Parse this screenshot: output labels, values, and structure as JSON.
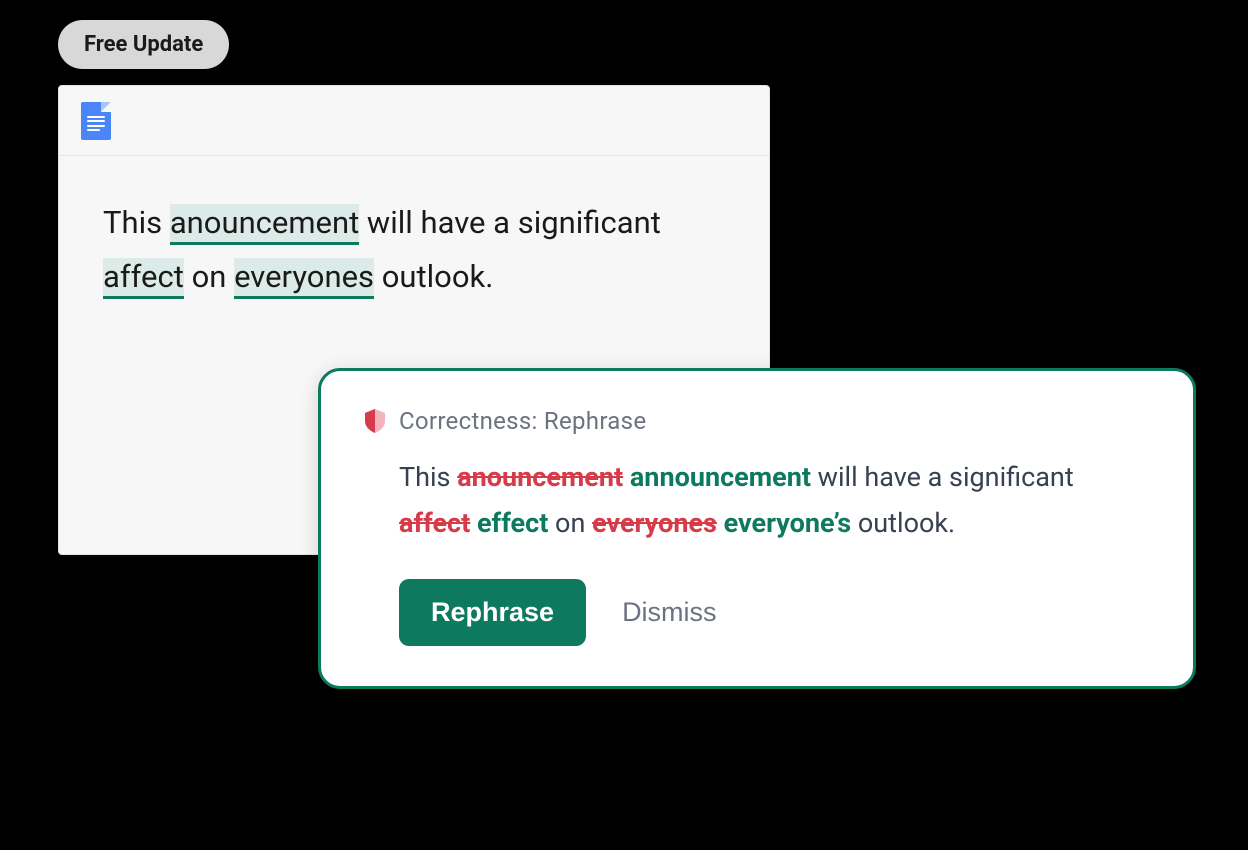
{
  "badge": "Free Update",
  "document": {
    "text_parts": [
      "This ",
      "anouncement",
      " will have a significant ",
      "affect",
      " on ",
      "everyones",
      " outlook."
    ]
  },
  "suggestion": {
    "category": "Correctness: Rephrase",
    "parts": [
      {
        "kind": "plain",
        "text": "This "
      },
      {
        "kind": "strike",
        "text": "anouncement"
      },
      {
        "kind": "plain",
        "text": " "
      },
      {
        "kind": "fix",
        "text": "announcement"
      },
      {
        "kind": "plain",
        "text": " will have a significant "
      },
      {
        "kind": "strike",
        "text": "affect"
      },
      {
        "kind": "plain",
        "text": " "
      },
      {
        "kind": "fix",
        "text": "effect"
      },
      {
        "kind": "plain",
        "text": " on "
      },
      {
        "kind": "strike",
        "text": "everyones"
      },
      {
        "kind": "plain",
        "text": " "
      },
      {
        "kind": "fix",
        "text": "everyone’s"
      },
      {
        "kind": "plain",
        "text": " outlook."
      }
    ],
    "primary_action": "Rephrase",
    "dismiss_action": "Dismiss"
  },
  "colors": {
    "accent_green": "#0d7a5f",
    "error_red": "#d63b4a",
    "highlight_bg": "#dcebe8"
  }
}
